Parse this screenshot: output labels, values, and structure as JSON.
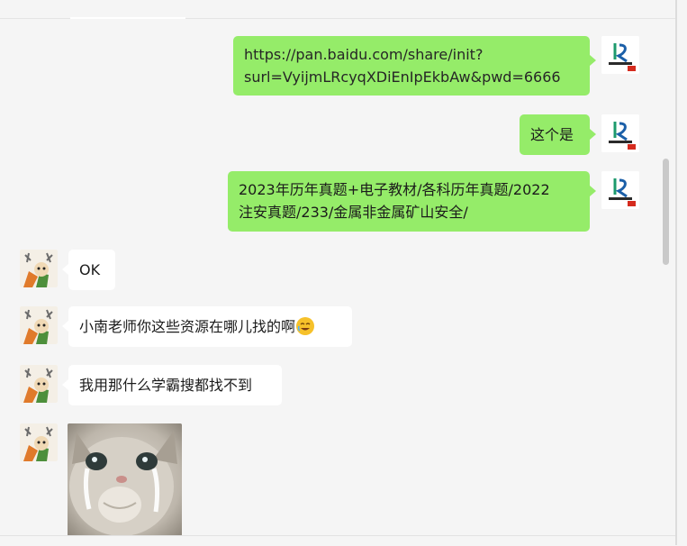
{
  "messages": {
    "m1": "https://pan.baidu.com/share/init?",
    "m1b": "surl=VyijmLRcyqXDiEnIpEkbAw&pwd=6666",
    "m2": "这个是",
    "m3a": "2023年历年真题+电子教材/各科历年真题/2022",
    "m3b": "注安真题/233/金属非金属矿山安全/",
    "m4": "OK",
    "m5": "小南老师你这些资源在哪儿找的啊",
    "m6": "我用那什么学霸搜都找不到"
  },
  "colors": {
    "self_bubble": "#95ec69",
    "other_bubble": "#ffffff",
    "background": "#f5f5f5"
  },
  "icons": {
    "self_avatar": "brand-logo-icon",
    "other_avatar": "cartoon-character-icon",
    "emoji": "laughing-crying-emoji-icon",
    "sticker": "crying-cat-sticker"
  }
}
